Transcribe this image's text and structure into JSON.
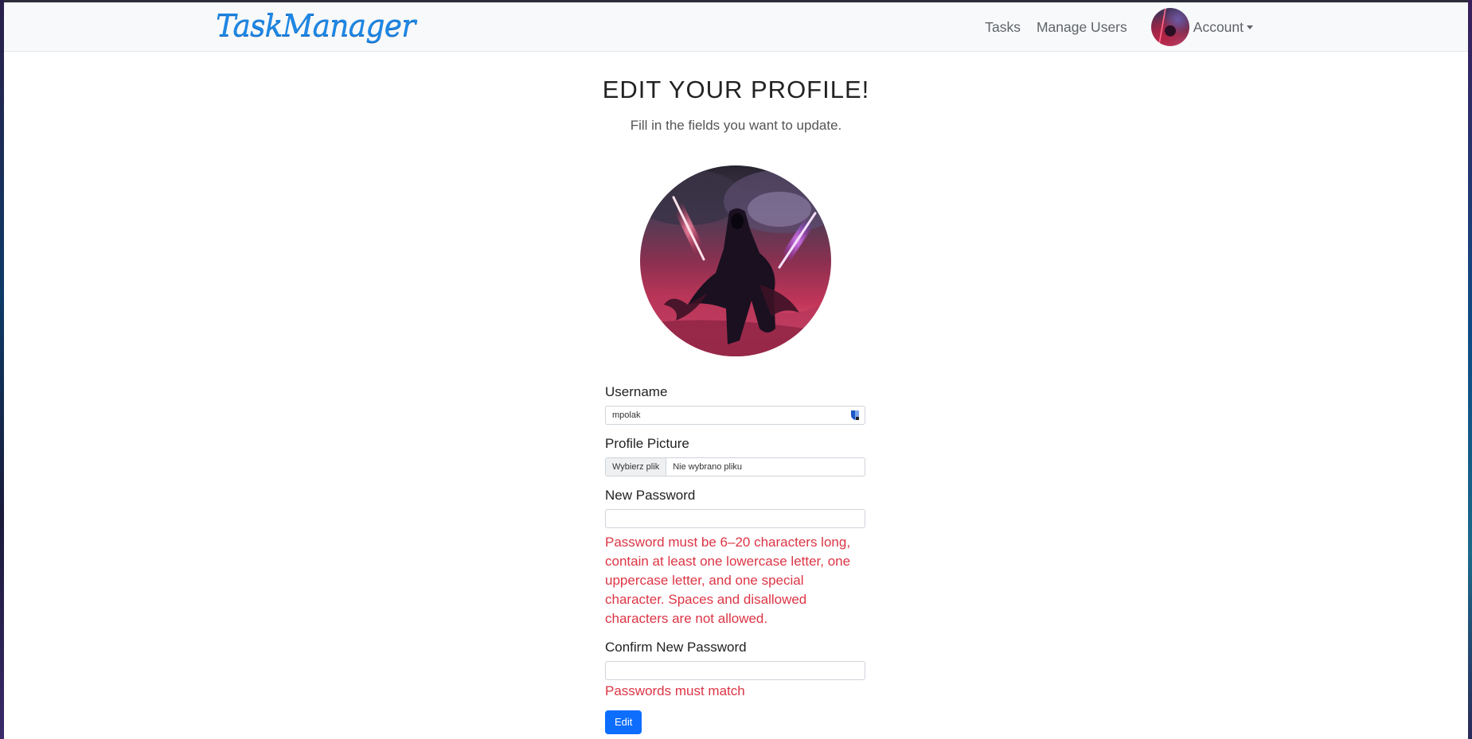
{
  "navbar": {
    "brand": "TaskManager",
    "links": [
      "Tasks",
      "Manage Users"
    ],
    "account_label": "Account"
  },
  "main": {
    "title": "EDIT YOUR PROFILE!",
    "subtitle": "Fill in the fields you want to update."
  },
  "form": {
    "username_label": "Username",
    "username_value": "mpolak",
    "profile_picture_label": "Profile Picture",
    "file_button_label": "Wybierz plik",
    "file_status": "Nie wybrano pliku",
    "new_password_label": "New Password",
    "new_password_value": "",
    "password_error": "Password must be 6–20 characters long, contain at least one lowercase letter, one uppercase letter, and one special character. Spaces and disallowed characters are not allowed.",
    "confirm_password_label": "Confirm New Password",
    "confirm_password_value": "",
    "confirm_error": "Passwords must match",
    "submit_label": "Edit"
  },
  "colors": {
    "brand": "#1e88e5",
    "primary_button": "#0d6efd",
    "error": "#dc3545",
    "navbar_bg": "#f8f9fa"
  },
  "icons": [
    "password-manager-shield-icon",
    "caret-down-icon"
  ]
}
